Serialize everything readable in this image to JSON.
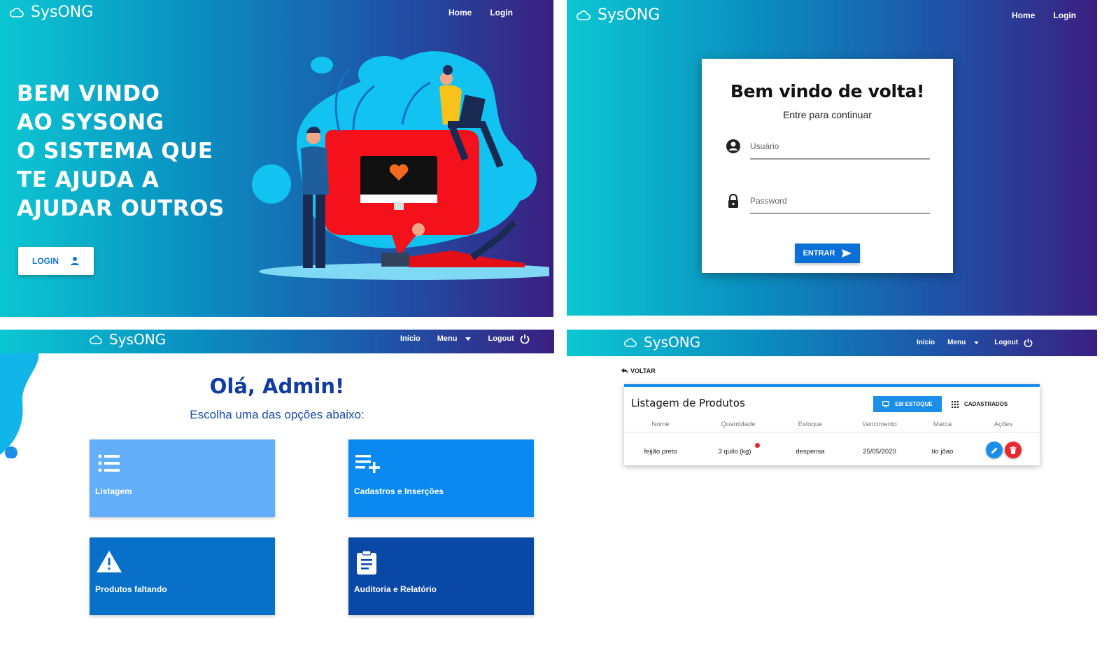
{
  "brand": {
    "name": "SysONG"
  },
  "landing": {
    "nav": [
      "Home",
      "Login"
    ],
    "hero_lines": [
      "BEM VINDO",
      "AO SYSONG",
      "O SISTEMA QUE",
      "TE AJUDA A",
      "AJUDAR OUTROS"
    ],
    "login_button": "LOGIN"
  },
  "login_page": {
    "nav": [
      "Home",
      "Login"
    ],
    "title": "Bem vindo de volta!",
    "subtitle": "Entre para continuar",
    "username_placeholder": "Usuário",
    "password_placeholder": "Password",
    "submit_button": "ENTRAR"
  },
  "dashboard": {
    "nav": {
      "inicio": "Início",
      "menu": "Menu",
      "logout": "Logout"
    },
    "greeting": "Olá, Admin!",
    "instruction": "Escolha uma das opções abaixo:",
    "tiles": [
      {
        "label": "Listagem",
        "color": "#63aef8"
      },
      {
        "label": "Cadastros e Inserções",
        "color": "#0a8af0"
      },
      {
        "label": "Produtos faltando",
        "color": "#0870c8"
      },
      {
        "label": "Auditoria e Relatório",
        "color": "#0a48a8"
      }
    ]
  },
  "products": {
    "nav": {
      "inicio": "Início",
      "menu": "Menu",
      "logout": "Logout"
    },
    "back": "VOLTAR",
    "title": "Listagem de Produtos",
    "filter_in_stock": "EM ESTOQUE",
    "filter_registered": "CADASTRADOS",
    "columns": [
      "Nome",
      "Quantidade",
      "Estoque",
      "Vencimento",
      "Marca",
      "Ações"
    ],
    "rows": [
      {
        "nome": "feijão preto",
        "quantidade": "3 quilo (kg)",
        "estoque": "despensa",
        "vencimento": "25/05/2020",
        "marca": "tio jõao"
      }
    ]
  },
  "colors": {
    "accent": "#0a6fd6",
    "heading_blue": "#0f3c9e",
    "delete_red": "#e9282f"
  }
}
